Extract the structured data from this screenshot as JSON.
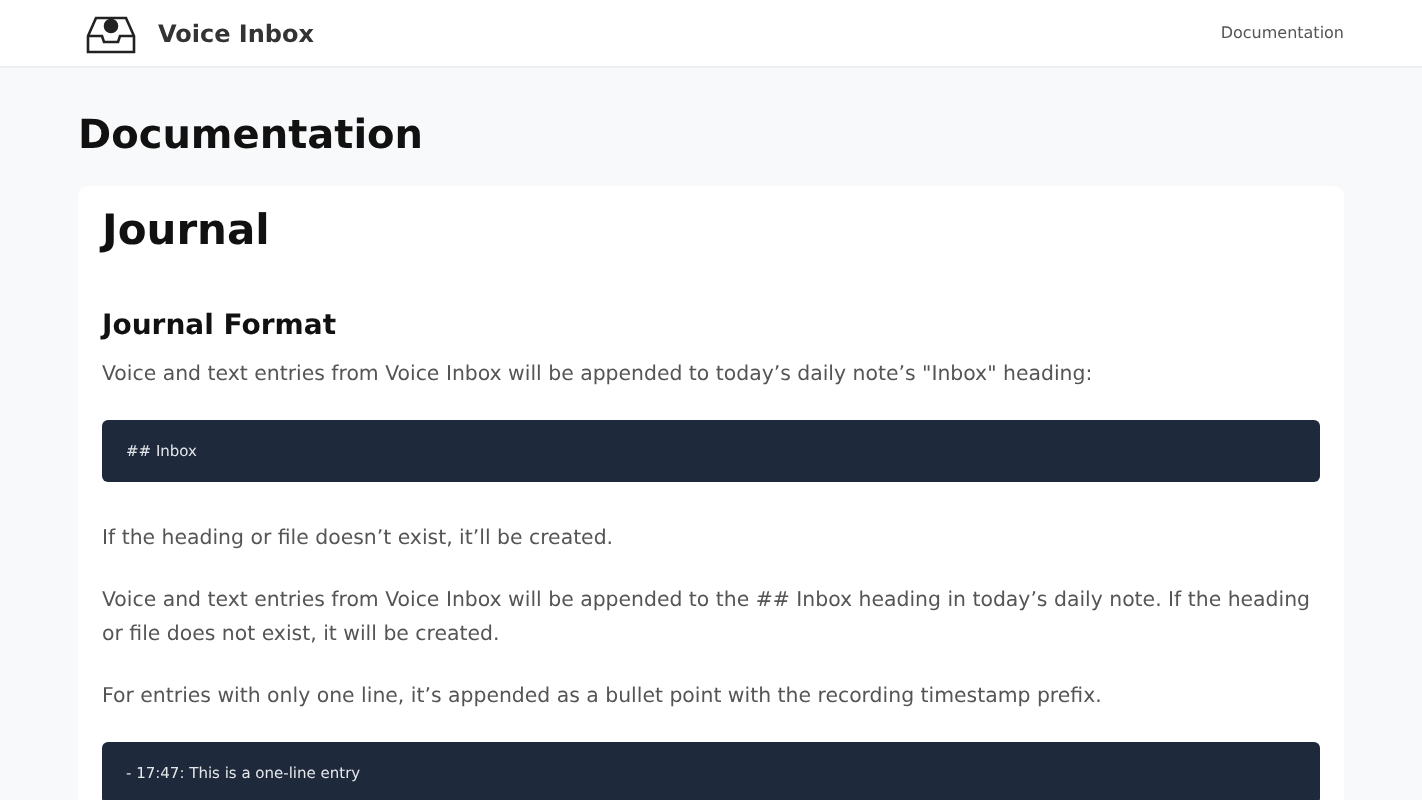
{
  "header": {
    "app_name": "Voice Inbox",
    "nav": [
      "Documentation"
    ]
  },
  "page_title": "Documentation",
  "card": {
    "title": "Journal",
    "section_title": "Journal Format",
    "blocks": [
      {
        "kind": "paragraph",
        "text": "Voice and text entries from Voice Inbox will be appended to today’s daily note’s \"Inbox\" heading:"
      },
      {
        "kind": "code",
        "text": "## Inbox"
      },
      {
        "kind": "paragraph",
        "text": "If the heading or file doesn’t exist, it’ll be created."
      },
      {
        "kind": "paragraph",
        "text": "Voice and text entries from Voice Inbox will be appended to the ## Inbox heading in today’s daily note. If the heading or file does not exist, it will be created."
      },
      {
        "kind": "paragraph",
        "text": "For entries with only one line, it’s appended as a bullet point with the recording timestamp prefix."
      },
      {
        "kind": "code",
        "text": "- 17:47: This is a one-line entry"
      }
    ]
  }
}
